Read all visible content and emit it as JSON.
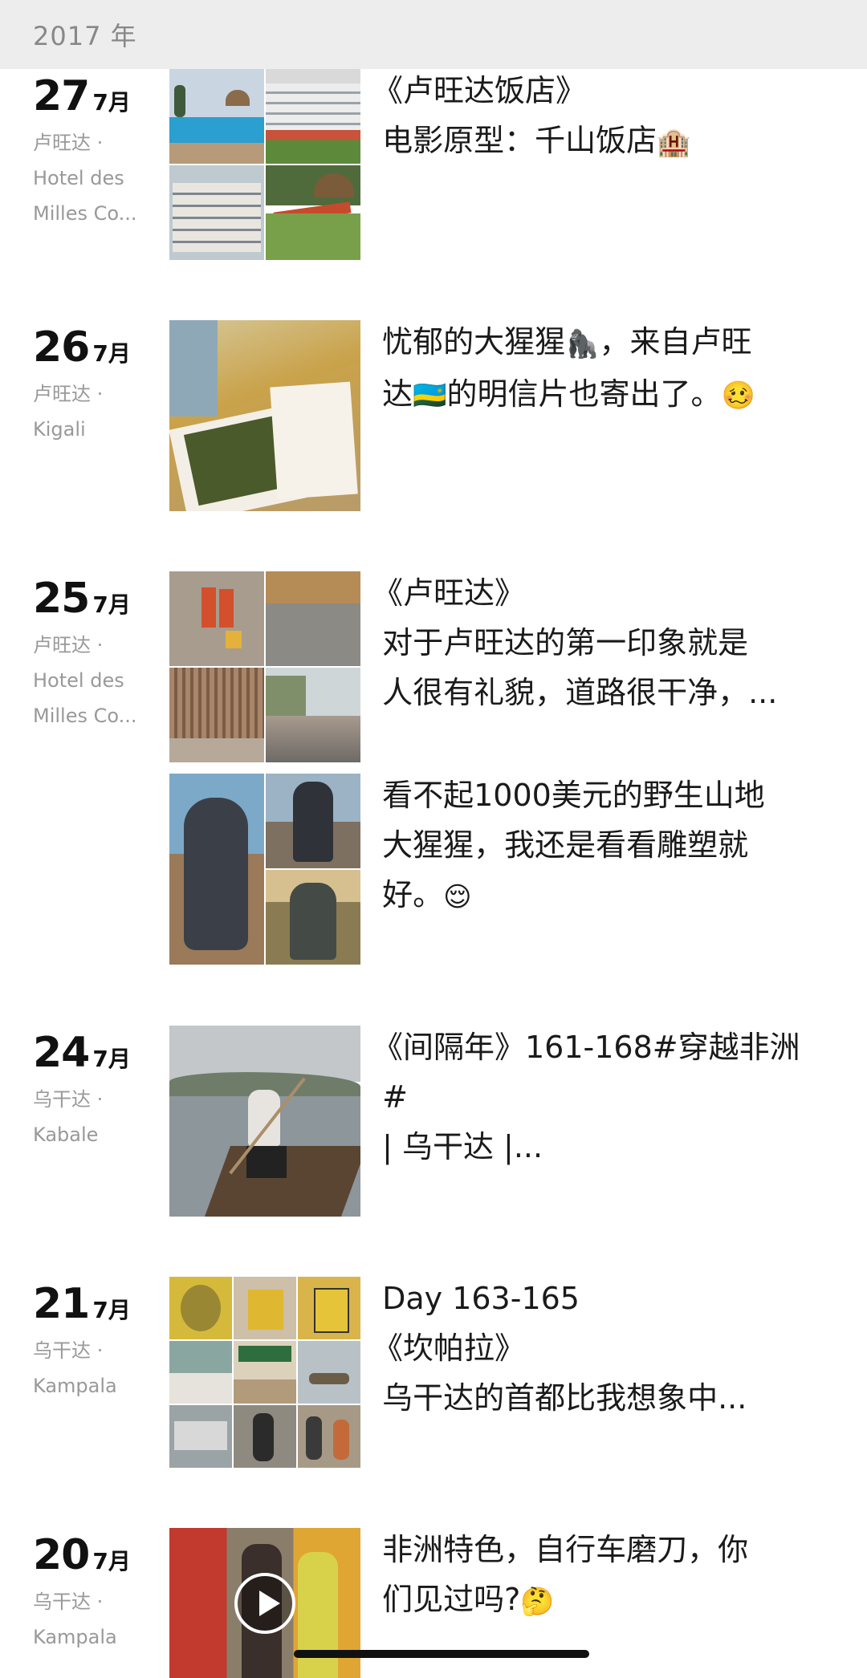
{
  "year_header": "2017 年",
  "entries": [
    {
      "day": "27",
      "month": "7月",
      "loc1": "卢旺达 ·",
      "loc2": "Hotel des",
      "loc3": "Milles Co...",
      "text": "《卢旺达饭店》\n 电影原型：千山饭店",
      "emoji": "🏨"
    },
    {
      "day": "26",
      "month": "7月",
      "loc1": "卢旺达 ·",
      "loc2": "Kigali",
      "text_a": " 忧郁的大猩猩",
      "emoji_a": "🦍",
      "text_b": "，来自卢旺\n 达",
      "emoji_b": "🇷🇼",
      "text_c": "的明信片也寄出了。",
      "emoji_c": "🥴"
    },
    {
      "day": "25",
      "month": "7月",
      "loc1": "卢旺达 ·",
      "loc2": "Hotel des",
      "loc3": "Milles Co...",
      "text": "《卢旺达》\n 对于卢旺达的第一印象就是\n 人很有礼貌，道路很干净，...",
      "text2": " 看不起1000美元的野生山地\n 大猩猩，我还是看看雕塑就\n 好。",
      "emoji2": "😌"
    },
    {
      "day": "24",
      "month": "7月",
      "loc1": "乌干达 ·",
      "loc2": "Kabale",
      "text": "《间隔年》161-168#穿越非洲\n #\n | 乌干达 |..."
    },
    {
      "day": "21",
      "month": "7月",
      "loc1": "乌干达 ·",
      "loc2": "Kampala",
      "text": " Day 163-165\n《坎帕拉》\n 乌干达的首都比我想象中..."
    },
    {
      "day": "20",
      "month": "7月",
      "loc1": "乌干达 ·",
      "loc2": "Kampala",
      "text": " 非洲特色，自行车磨刀，你\n 们见过吗?",
      "emoji": "🤔"
    }
  ],
  "icons": {
    "video": "play-icon"
  },
  "colors": {
    "header_bg": "#ededed",
    "muted": "#999999",
    "text": "#1a1a1a"
  }
}
